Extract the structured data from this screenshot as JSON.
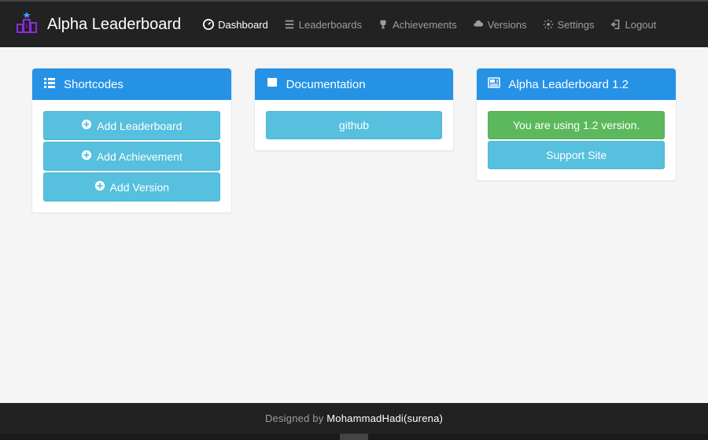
{
  "brand": {
    "title": "Alpha Leaderboard"
  },
  "nav": {
    "items": [
      {
        "label": "Dashboard",
        "active": true
      },
      {
        "label": "Leaderboards",
        "active": false
      },
      {
        "label": "Achievements",
        "active": false
      },
      {
        "label": "Versions",
        "active": false
      },
      {
        "label": "Settings",
        "active": false
      },
      {
        "label": "Logout",
        "active": false
      }
    ]
  },
  "panels": {
    "shortcodes": {
      "title": "Shortcodes",
      "buttons": [
        {
          "label": "Add Leaderboard"
        },
        {
          "label": "Add Achievement"
        },
        {
          "label": "Add Version"
        }
      ]
    },
    "documentation": {
      "title": "Documentation",
      "buttons": [
        {
          "label": "github"
        }
      ]
    },
    "about": {
      "title": "Alpha Leaderboard 1.2",
      "version_notice": "You are using 1.2 version.",
      "support_label": "Support Site"
    }
  },
  "footer": {
    "prefix": "Designed by ",
    "credit": "MohammadHadi(surena)"
  }
}
